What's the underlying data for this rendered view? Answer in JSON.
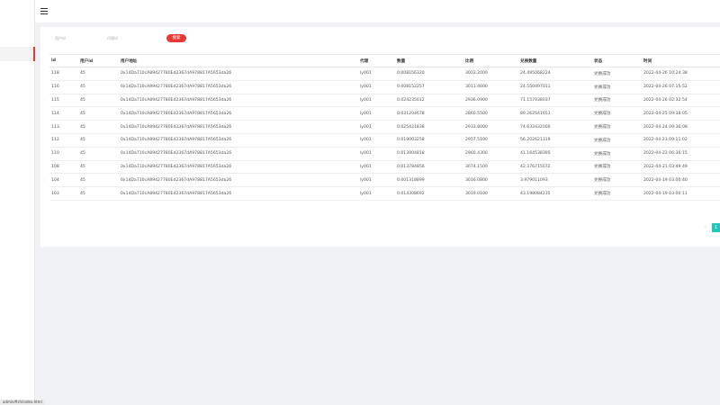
{
  "filters": {
    "user_id_placeholder": "用户id",
    "proxy_placeholder": "代理id",
    "search_label": "搜索"
  },
  "table": {
    "headers": [
      "id",
      "用户id",
      "用户地址",
      "代理",
      "数量",
      "比例",
      "兑换数量",
      "状态",
      "时间"
    ],
    "rows": [
      [
        "118",
        "45",
        "0x14Da710cA89427780Ed2367dA978817A5653da26",
        "ly001",
        "0.008156320",
        "3003.2000",
        "24.495068224",
        "兑换成功",
        "2022-04-26 10:24:38"
      ],
      [
        "116",
        "45",
        "0x14Da710cA89427780Ed2367dA978817A5653da26",
        "ly001",
        "0.008152257",
        "3011.4600",
        "24.550497011",
        "兑换成功",
        "2022-04-26 07:15:52"
      ],
      [
        "115",
        "45",
        "0x14Da710cA89427780Ed2367dA978817A5653da26",
        "ly001",
        "0.024235612",
        "2936.0900",
        "71.157938037",
        "兑换成功",
        "2022-04-26 02:32:54"
      ],
      [
        "114",
        "45",
        "0x14Da710cA89427780Ed2367dA978817A5653da26",
        "ly001",
        "0.031204678",
        "2860.5500",
        "89.262541653",
        "兑换成功",
        "2022-04-25 09:38:05"
      ],
      [
        "113",
        "45",
        "0x14Da710cA89427780Ed2367dA978817A5653da26",
        "ly001",
        "0.025421838",
        "2933.8000",
        "74.633432000",
        "兑换成功",
        "2022-04-24 09:36:08"
      ],
      [
        "112",
        "45",
        "0x14Da710cA89427780Ed2367dA978817A5653da26",
        "ly001",
        "0.019003258",
        "2957.5100",
        "56.202621319",
        "兑换成功",
        "2022-04-23 09:11:02"
      ],
      [
        "110",
        "45",
        "0x14Da710cA89427780Ed2367dA978817A5653da26",
        "ly001",
        "0.013904818",
        "2960.4300",
        "41.164538395",
        "兑换成功",
        "2022-04-22 06:36:15"
      ],
      [
        "108",
        "45",
        "0x14Da710cA89427780Ed2367dA978817A5653da26",
        "ly001",
        "0.013784856",
        "3074.1500",
        "42.376715072",
        "兑换成功",
        "2022-04-21 03:49:49"
      ],
      [
        "104",
        "45",
        "0x14Da710cA89427780Ed2367dA978817A5653da26",
        "ly001",
        "0.001318899",
        "3016.0800",
        "3.979011093",
        "兑换成功",
        "2022-04-19 03:00:40"
      ],
      [
        "103",
        "45",
        "0x14Da710cA89427780Ed2367dA978817A5653da26",
        "ly001",
        "0.014308692",
        "3019.0100",
        "43.198084235",
        "兑换成功",
        "2022-04-19 03:00:11"
      ]
    ]
  },
  "pagination": {
    "prev": "‹",
    "current": "1"
  },
  "status_bar": {
    "url": "admin/fish/index.html"
  },
  "colors": {
    "accent": "#e53935",
    "page_active": "#26c6b8"
  }
}
